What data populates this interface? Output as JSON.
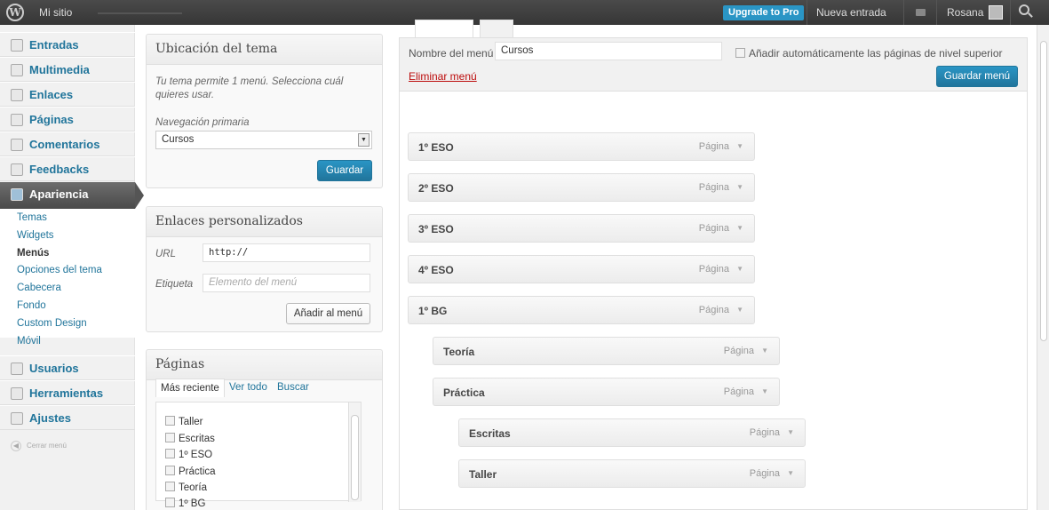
{
  "adminbar": {
    "wp_logo": "W",
    "site": "Mi sitio",
    "upgrade": "Upgrade to Pro",
    "new_entry": "Nueva entrada",
    "user": "Rosana"
  },
  "sidebar": {
    "items": [
      {
        "label": "Entradas",
        "icon": "pin-icon"
      },
      {
        "label": "Multimedia",
        "icon": "media-icon"
      },
      {
        "label": "Enlaces",
        "icon": "link-icon"
      },
      {
        "label": "Páginas",
        "icon": "page-icon"
      },
      {
        "label": "Comentarios",
        "icon": "comment-icon"
      },
      {
        "label": "Feedbacks",
        "icon": "feedback-icon"
      },
      {
        "label": "Apariencia",
        "icon": "appearance-icon"
      }
    ],
    "submenu": [
      "Temas",
      "Widgets",
      "Menús",
      "Opciones del tema",
      "Cabecera",
      "Fondo",
      "Custom Design",
      "Móvil"
    ],
    "items2": [
      {
        "label": "Usuarios",
        "icon": "users-icon"
      },
      {
        "label": "Herramientas",
        "icon": "tools-icon"
      },
      {
        "label": "Ajustes",
        "icon": "settings-icon"
      }
    ],
    "collapse": "Cerrar menú"
  },
  "location": {
    "title": "Ubicación del tema",
    "desc1": "Tu tema permite 1 menú. Selecciona cuál",
    "desc2": "quieres usar.",
    "nav_label": "Navegación primaria",
    "selected": "Cursos",
    "save": "Guardar"
  },
  "links": {
    "title": "Enlaces personalizados",
    "url_label": "URL",
    "url_value": "http://",
    "label_label": "Etiqueta",
    "label_placeholder": "Elemento del menú",
    "add": "Añadir al menú"
  },
  "pages": {
    "title": "Páginas",
    "tabs": [
      "Más reciente",
      "Ver todo",
      "Buscar"
    ],
    "list": [
      "Taller",
      "Escritas",
      "1º ESO",
      "Práctica",
      "Teoría",
      "1º BG"
    ]
  },
  "menu": {
    "name_label": "Nombre del menú",
    "name_value": "Cursos",
    "auto_add": "Añadir automáticamente las páginas de nivel superior",
    "delete": "Eliminar menú",
    "save": "Guardar menú",
    "items": [
      {
        "title": "1º ESO",
        "type": "Página",
        "depth": 0
      },
      {
        "title": "2º ESO",
        "type": "Página",
        "depth": 0
      },
      {
        "title": "3º ESO",
        "type": "Página",
        "depth": 0
      },
      {
        "title": "4º ESO",
        "type": "Página",
        "depth": 0
      },
      {
        "title": "1º BG",
        "type": "Página",
        "depth": 0
      },
      {
        "title": "Teoría",
        "type": "Página",
        "depth": 1
      },
      {
        "title": "Práctica",
        "type": "Página",
        "depth": 1
      },
      {
        "title": "Escritas",
        "type": "Página",
        "depth": 2
      },
      {
        "title": "Taller",
        "type": "Página",
        "depth": 2
      }
    ]
  }
}
